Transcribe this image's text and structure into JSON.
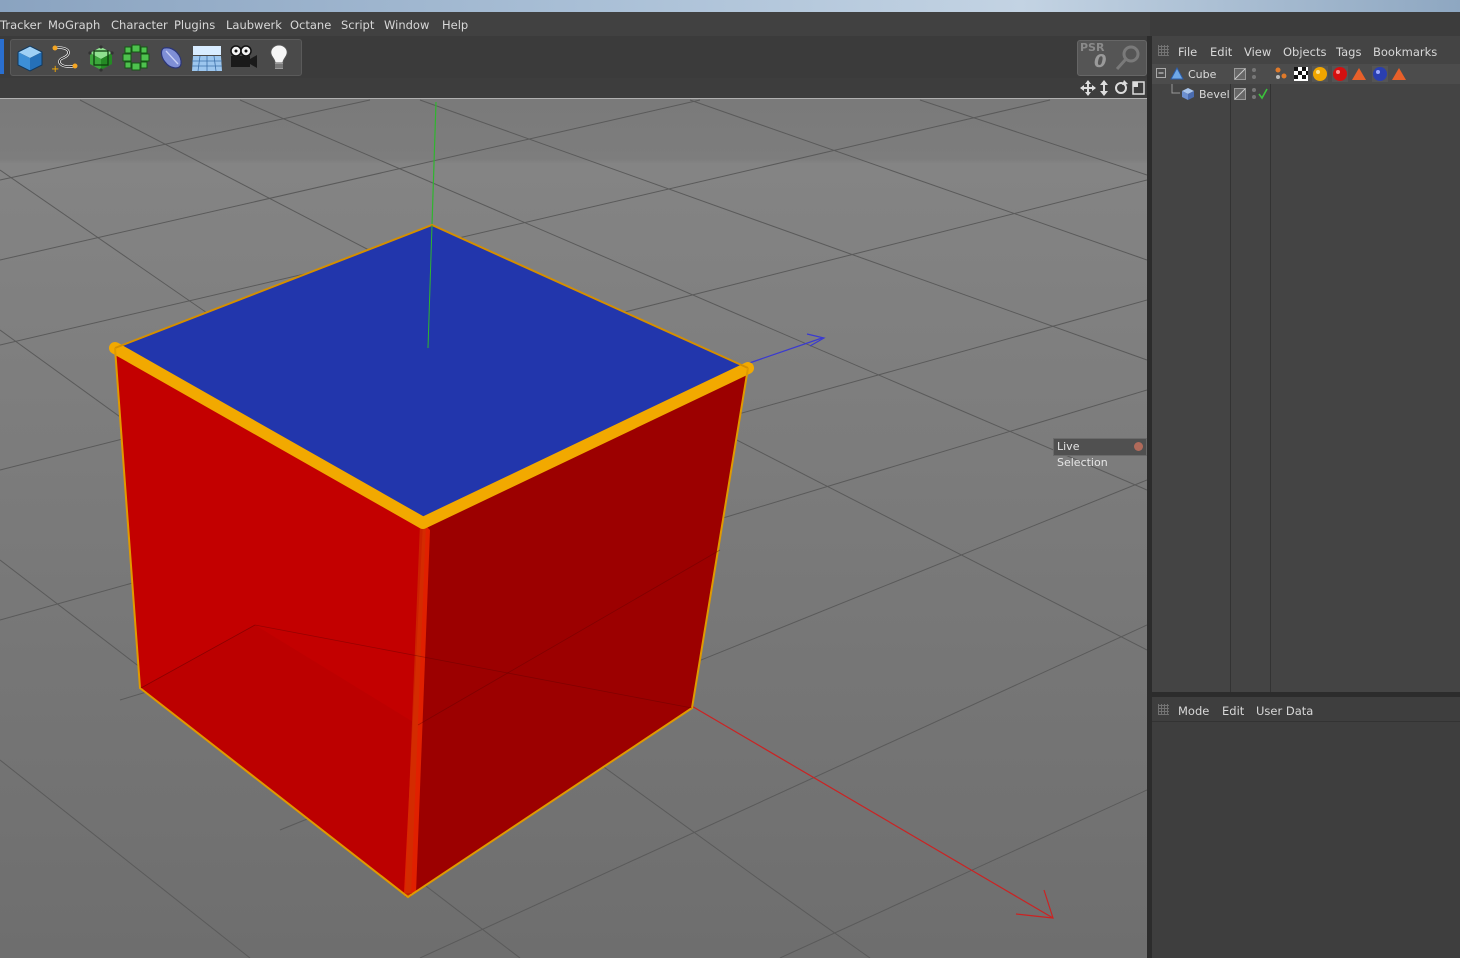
{
  "menu": {
    "items": [
      "Tracker",
      "MoGraph",
      "Character",
      "Plugins",
      "Laubwerk",
      "Octane",
      "Script",
      "Window",
      "Help"
    ]
  },
  "toolbar": {
    "buttons": [
      {
        "name": "cube-icon"
      },
      {
        "name": "pen-spline-icon"
      },
      {
        "name": "subdivision-icon"
      },
      {
        "name": "cloner-icon"
      },
      {
        "name": "deformer-icon"
      },
      {
        "name": "floor-icon"
      },
      {
        "name": "camera-icon"
      },
      {
        "name": "light-icon"
      }
    ],
    "psr_label": "PSR",
    "psr_value": "0"
  },
  "viewport": {
    "nav_icons": [
      "move-view-icon",
      "zoom-view-icon",
      "rotate-view-icon",
      "maximize-view-icon"
    ],
    "hud_label": "Live Selection"
  },
  "object_manager": {
    "menu": [
      "File",
      "Edit",
      "View",
      "Objects",
      "Tags",
      "Bookmarks"
    ],
    "objects": [
      {
        "name": "Cube",
        "type": "cube-object-icon"
      },
      {
        "name": "Bevel",
        "type": "bevel-deformer-icon"
      }
    ],
    "tags": [
      "texture-tag-icon",
      "checker-tag-icon",
      "material-orange-icon",
      "material-red-icon",
      "phong-tag-icon",
      "material-blue-icon",
      "phong-tag-icon"
    ]
  },
  "attribute_manager": {
    "menu": [
      "Mode",
      "Edit",
      "User Data"
    ]
  },
  "colors": {
    "cube_top": "#2236ac",
    "cube_left": "#c30000",
    "cube_right": "#9c0000",
    "bevel_edge": "#f2a900",
    "viewport_bg": "#7a7a7a"
  }
}
